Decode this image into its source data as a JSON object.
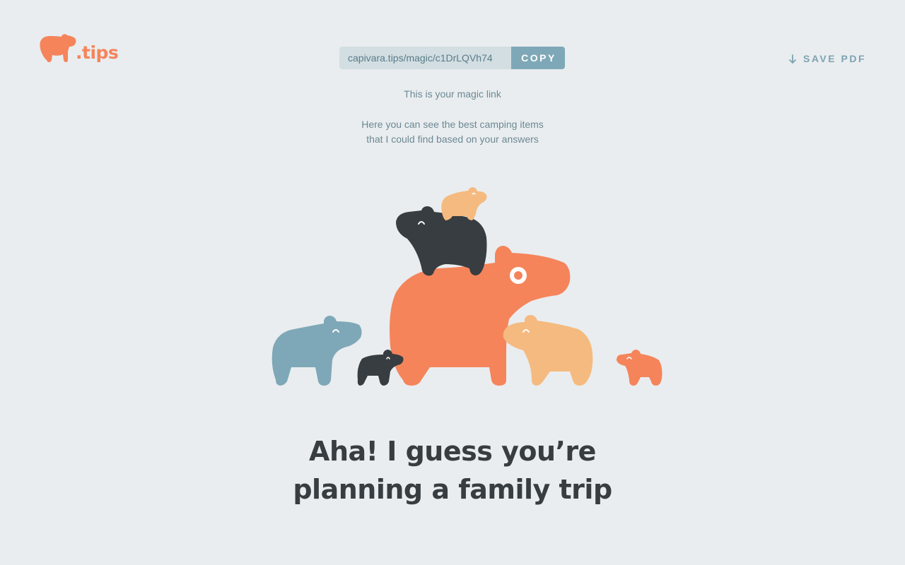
{
  "logo": {
    "text": ".tips",
    "icon": "capybara-icon"
  },
  "magic_link": {
    "url": "capivara.tips/magic/c1DrLQVh74",
    "copy_label": "COPY",
    "caption": "This is your magic link"
  },
  "save_pdf": {
    "label": "SAVE PDF",
    "icon": "arrow-down-icon"
  },
  "description": {
    "line1": "Here you can see the best camping items",
    "line2": "that I could find based on your answers"
  },
  "headline": {
    "line1": "Aha! I guess you’re",
    "line2": "planning a family trip"
  },
  "colors": {
    "background": "#e9edef",
    "orange": "#f5845b",
    "peach": "#f5ba7f",
    "dark": "#373d41",
    "blue": "#7ea8b7",
    "link_bg": "#d2dee2"
  }
}
